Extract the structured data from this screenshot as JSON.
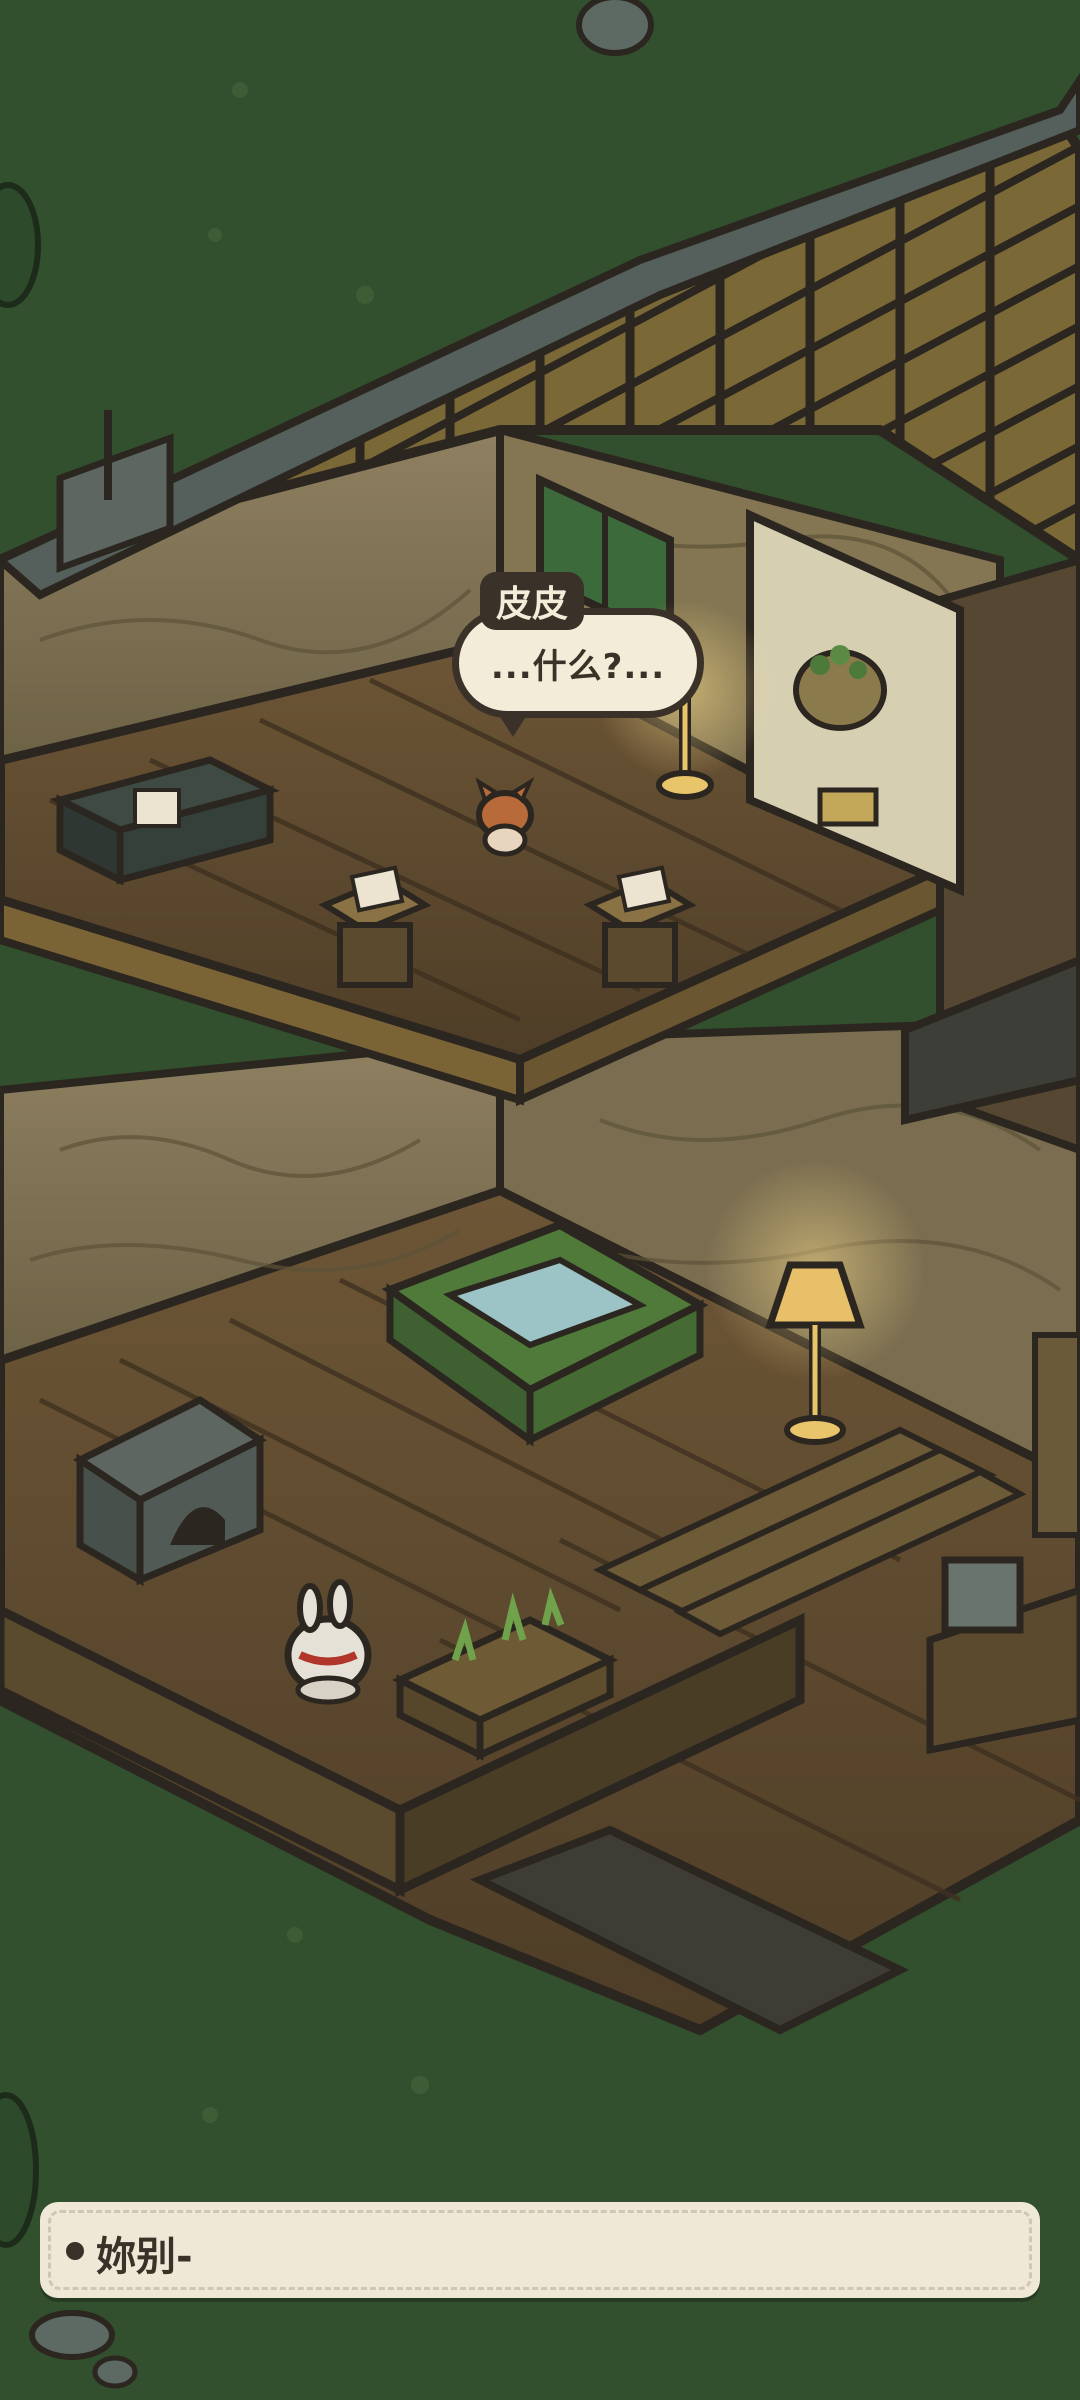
{
  "speech_bubble": {
    "speaker": "皮皮",
    "text": "...什么?..."
  },
  "dialogue_box": {
    "text": "妳别-"
  },
  "colors": {
    "grass": "#33502e",
    "roof": "#6b5a30",
    "floor": "#5e4a2f",
    "wall": "#8a7a58",
    "lamp_glow": "#f5d98a",
    "outline": "#2c2620",
    "dialog_bg": "#efe8d6"
  },
  "icons": {
    "bunny": "bunny-character",
    "fox": "fox-character",
    "lamp": "floor-lamp"
  }
}
